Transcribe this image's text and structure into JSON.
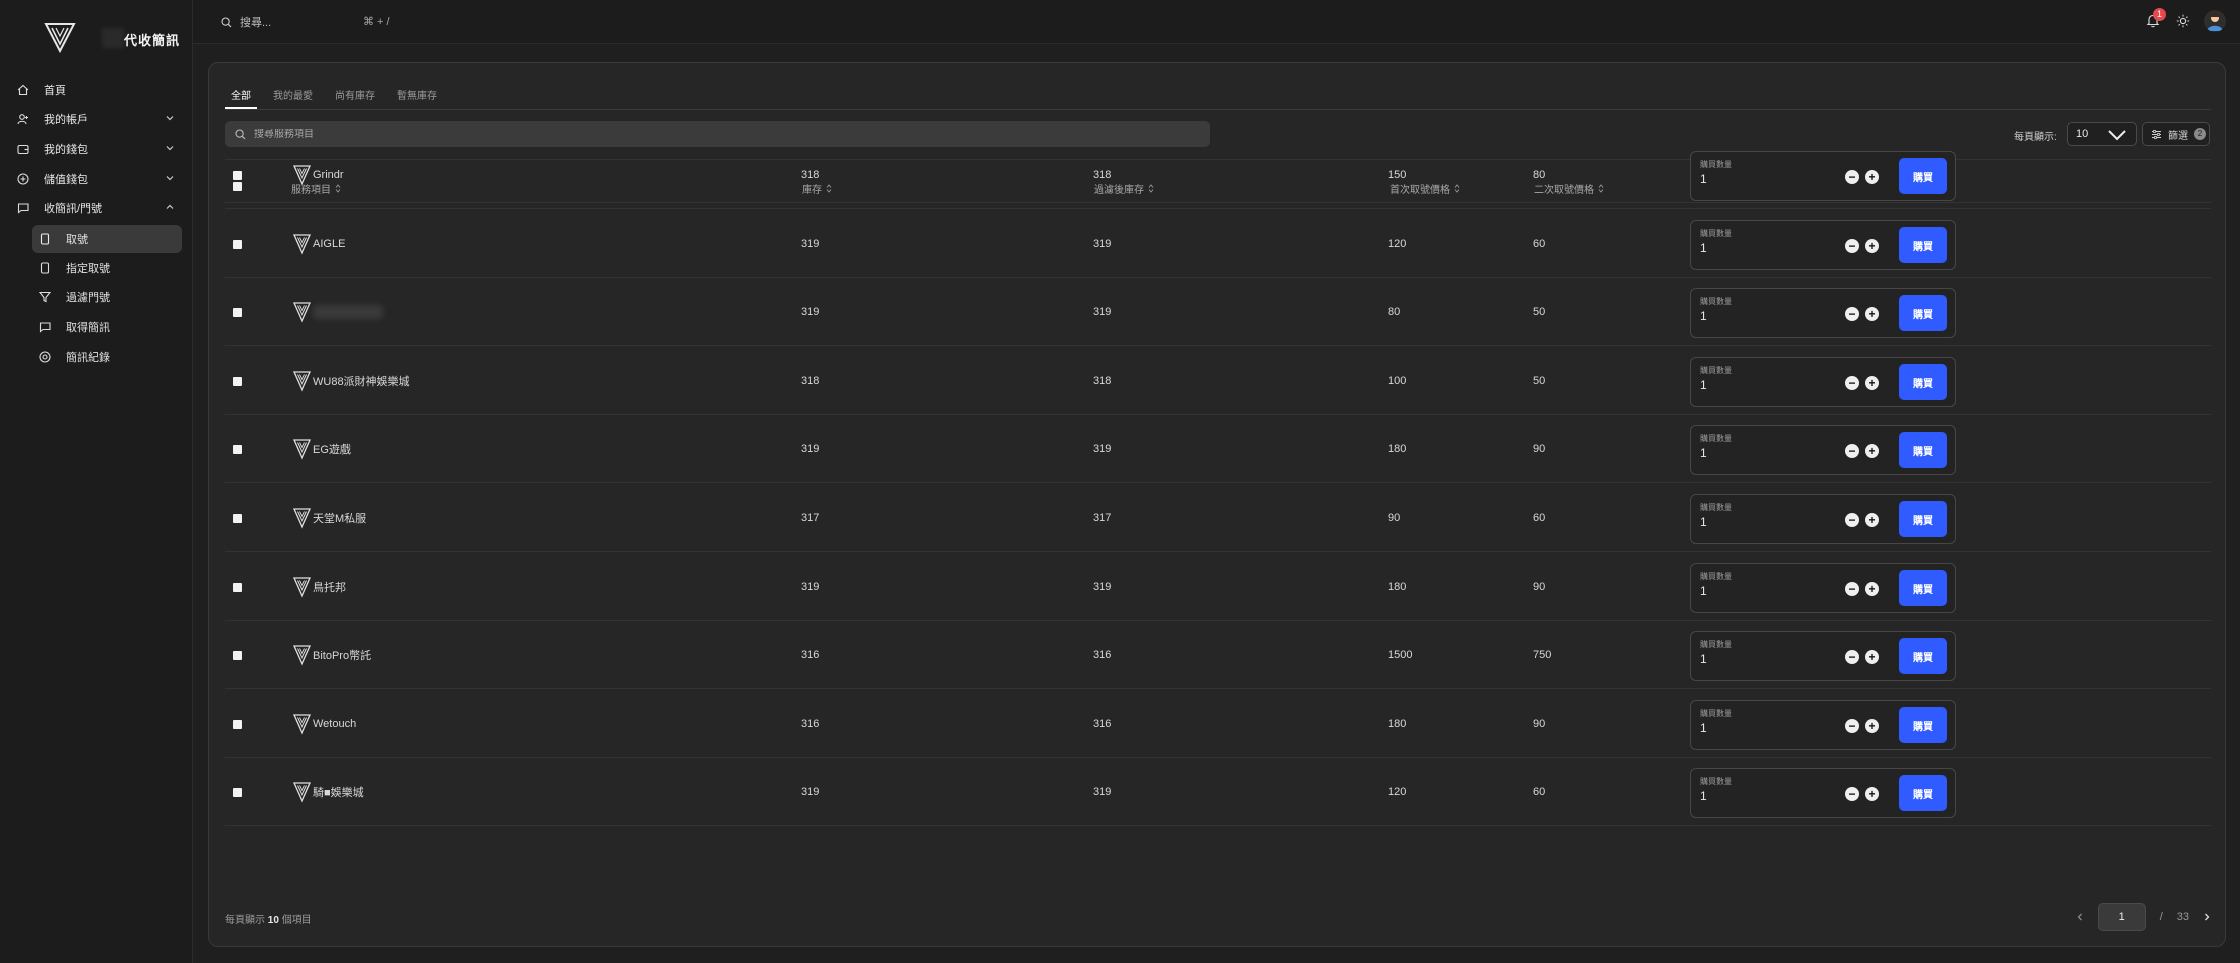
{
  "brand": {
    "title": "代收簡訊"
  },
  "sidebar": {
    "items": [
      {
        "label": "首頁",
        "icon": "home-icon"
      },
      {
        "label": "我的帳戶",
        "icon": "user-icon"
      },
      {
        "label": "我的錢包",
        "icon": "wallet-icon"
      },
      {
        "label": "儲值錢包",
        "icon": "plus-circle-icon"
      },
      {
        "label": "收簡訊/門號",
        "icon": "message-icon"
      }
    ],
    "subitems": [
      {
        "label": "取號",
        "icon": "phone-icon"
      },
      {
        "label": "指定取號",
        "icon": "phone-icon"
      },
      {
        "label": "過濾門號",
        "icon": "filter-icon"
      },
      {
        "label": "取得簡訊",
        "icon": "message-icon"
      },
      {
        "label": "簡訊紀錄",
        "icon": "target-icon"
      }
    ]
  },
  "topbar": {
    "search_placeholder": "搜尋...",
    "shortcut": "⌘ + /",
    "notification_count": "1"
  },
  "tabs": [
    "全部",
    "我的最愛",
    "尚有庫存",
    "暫無庫存"
  ],
  "search": {
    "placeholder": "搜尋服務項目"
  },
  "per_page": {
    "label": "每頁顯示:",
    "value": "10"
  },
  "filter": {
    "label": "篩選",
    "count": "2"
  },
  "table": {
    "headers": [
      "服務項目",
      "庫存",
      "過濾後庫存",
      "首次取號價格",
      "二次取號價格"
    ],
    "qty_label": "購買數量",
    "buy_label": "購買",
    "rows": [
      {
        "name": "Grindr",
        "stock": "318",
        "filtered": "318",
        "first": "150",
        "second": "80",
        "qty": "1"
      },
      {
        "name": "AIGLE",
        "stock": "319",
        "filtered": "319",
        "first": "120",
        "second": "60",
        "qty": "1"
      },
      {
        "name": "",
        "stock": "319",
        "filtered": "319",
        "first": "80",
        "second": "50",
        "qty": "1"
      },
      {
        "name": "WU88派財神娛樂城",
        "stock": "318",
        "filtered": "318",
        "first": "100",
        "second": "50",
        "qty": "1"
      },
      {
        "name": "EG遊戲",
        "stock": "319",
        "filtered": "319",
        "first": "180",
        "second": "90",
        "qty": "1"
      },
      {
        "name": "天堂M私服",
        "stock": "317",
        "filtered": "317",
        "first": "90",
        "second": "60",
        "qty": "1"
      },
      {
        "name": "鳥托邦",
        "stock": "319",
        "filtered": "319",
        "first": "180",
        "second": "90",
        "qty": "1"
      },
      {
        "name": "BitoPro幣託",
        "stock": "316",
        "filtered": "316",
        "first": "1500",
        "second": "750",
        "qty": "1"
      },
      {
        "name": "Wetouch",
        "stock": "316",
        "filtered": "316",
        "first": "180",
        "second": "90",
        "qty": "1"
      },
      {
        "name": "騎■娛樂城",
        "stock": "319",
        "filtered": "319",
        "first": "120",
        "second": "60",
        "qty": "1"
      }
    ]
  },
  "footer": {
    "prefix": "每頁顯示",
    "count": "10",
    "suffix": "個項目"
  },
  "pagination": {
    "current": "1",
    "separator": "/",
    "total": "33"
  },
  "colors": {
    "accent": "#2f5bff",
    "badge": "#e5484d",
    "background": "#1f1f1f",
    "panel": "#262626"
  }
}
